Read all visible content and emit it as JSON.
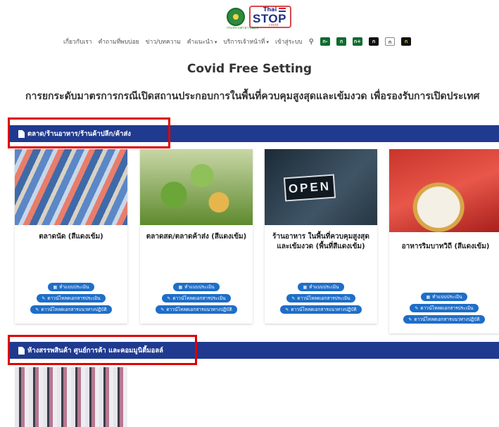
{
  "header": {
    "moph_label": "กระทรวงสาธารณสุข",
    "stop_thai": "Thai",
    "stop_word": "STOP",
    "stop_covid": "covid"
  },
  "nav": {
    "items": [
      "เกี่ยวกับเรา",
      "คำถามที่พบบ่อย",
      "ข่าว/บทความ",
      "คำแนะนำ",
      "บริการเจ้าหน้าที่",
      "เข้าสู่ระบบ"
    ],
    "toggles": [
      "ก-",
      "ก",
      "ก+",
      "ก",
      "ก",
      "ก"
    ]
  },
  "page": {
    "title": "Covid Free Setting",
    "subtitle": "การยกระดับมาตรการกรณีเปิดสถานประกอบการในพื้นที่ควบคุมสูงสุดและเข้มงวด เพื่อรองรับการเปิดประเทศ"
  },
  "sections": [
    {
      "title": "ตลาด/ร้านอาหาร/ร้านค้าปลีก/ค้าส่ง",
      "cards": [
        {
          "title": "ตลาดนัด (สีแดงเข้ม)"
        },
        {
          "title": "ตลาดสด/ตลาดค้าส่ง (สีแดงเข้ม)"
        },
        {
          "title": "ร้านอาหาร ในพื้นที่ควบคุมสูงสุดและเข้มงวด (พื้นที่สีแดงเข้ม)",
          "sign": "OPEN"
        },
        {
          "title": "อาหารริมบาทวิถี (สีแดงเข้ม)"
        }
      ]
    },
    {
      "title": "ห้างสรรพสินค้า ศูนย์การค้า และคอมมูนิตี้มอลล์"
    }
  ],
  "buttons": {
    "form": "ทำแบบประเมิน",
    "download_eval": "ดาวน์โหลดเอกสารประเมิน",
    "download_guide": "ดาวน์โหลดเอกสารแนวทางปฏิบัติ"
  }
}
